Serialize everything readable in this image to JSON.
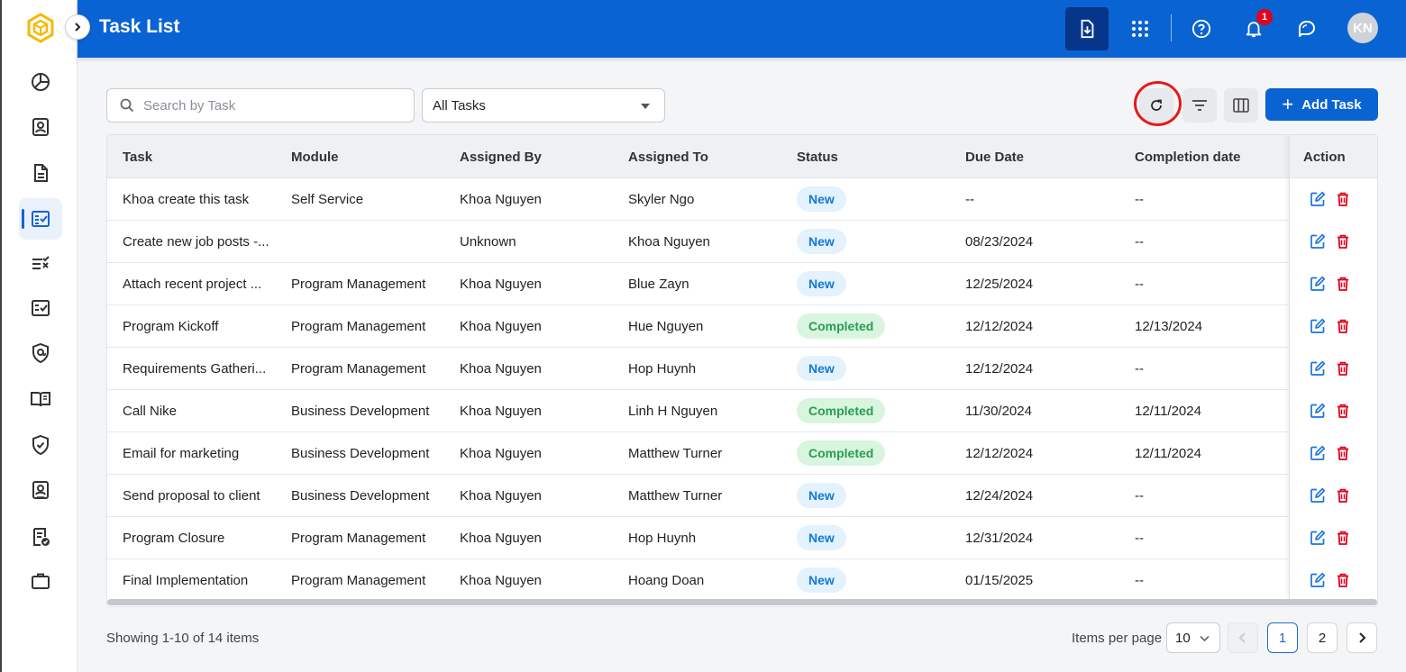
{
  "header": {
    "title": "Task List",
    "notification_count": "1",
    "avatar_initials": "KN"
  },
  "toolbar": {
    "search_placeholder": "Search by Task",
    "filter_select_value": "All Tasks",
    "add_task_label": "Add Task"
  },
  "table": {
    "columns": [
      "Task",
      "Module",
      "Assigned By",
      "Assigned To",
      "Status",
      "Due Date",
      "Completion date",
      "Action"
    ],
    "rows": [
      {
        "task": "Khoa create this task",
        "module": "Self Service",
        "assigned_by": "Khoa Nguyen",
        "assigned_to": "Skyler Ngo",
        "status": "New",
        "due_date": "--",
        "completion_date": "--"
      },
      {
        "task": "Create new job posts -...",
        "module": "",
        "assigned_by": "Unknown",
        "assigned_to": "Khoa Nguyen",
        "status": "New",
        "due_date": "08/23/2024",
        "completion_date": "--"
      },
      {
        "task": "Attach recent project ...",
        "module": "Program Management",
        "assigned_by": "Khoa Nguyen",
        "assigned_to": "Blue Zayn",
        "status": "New",
        "due_date": "12/25/2024",
        "completion_date": "--"
      },
      {
        "task": "Program Kickoff",
        "module": "Program Management",
        "assigned_by": "Khoa Nguyen",
        "assigned_to": "Hue Nguyen",
        "status": "Completed",
        "due_date": "12/12/2024",
        "completion_date": "12/13/2024"
      },
      {
        "task": "Requirements Gatheri...",
        "module": "Program Management",
        "assigned_by": "Khoa Nguyen",
        "assigned_to": "Hop Huynh",
        "status": "New",
        "due_date": "12/12/2024",
        "completion_date": "--"
      },
      {
        "task": "Call Nike",
        "module": "Business Development",
        "assigned_by": "Khoa Nguyen",
        "assigned_to": "Linh H Nguyen",
        "status": "Completed",
        "due_date": "11/30/2024",
        "completion_date": "12/11/2024"
      },
      {
        "task": "Email for marketing",
        "module": "Business Development",
        "assigned_by": "Khoa Nguyen",
        "assigned_to": "Matthew Turner",
        "status": "Completed",
        "due_date": "12/12/2024",
        "completion_date": "12/11/2024"
      },
      {
        "task": "Send proposal to client",
        "module": "Business Development",
        "assigned_by": "Khoa Nguyen",
        "assigned_to": "Matthew Turner",
        "status": "New",
        "due_date": "12/24/2024",
        "completion_date": "--"
      },
      {
        "task": "Program Closure",
        "module": "Program Management",
        "assigned_by": "Khoa Nguyen",
        "assigned_to": "Hop Huynh",
        "status": "New",
        "due_date": "12/31/2024",
        "completion_date": "--"
      },
      {
        "task": "Final Implementation",
        "module": "Program Management",
        "assigned_by": "Khoa Nguyen",
        "assigned_to": "Hoang Doan",
        "status": "New",
        "due_date": "01/15/2025",
        "completion_date": "--"
      }
    ]
  },
  "footer": {
    "showing_text": "Showing 1-10 of 14 items",
    "items_per_page_label": "Items per page",
    "items_per_page_value": "10",
    "pages": [
      "1",
      "2"
    ],
    "current_page": "1"
  },
  "sidebar": {
    "items": [
      "dashboard-icon",
      "contacts-icon",
      "document-icon",
      "task-list-icon",
      "checklist-icon",
      "approval-icon",
      "security-icon",
      "library-icon",
      "shield-check-icon",
      "profile-card-icon",
      "report-check-icon",
      "briefcase-icon"
    ],
    "active_index": 3
  },
  "colors": {
    "primary": "#0a63d3",
    "new_status": "#1578d8",
    "completed_status": "#2a9d52",
    "delete": "#e0001a",
    "highlight_ring": "#e61919"
  }
}
